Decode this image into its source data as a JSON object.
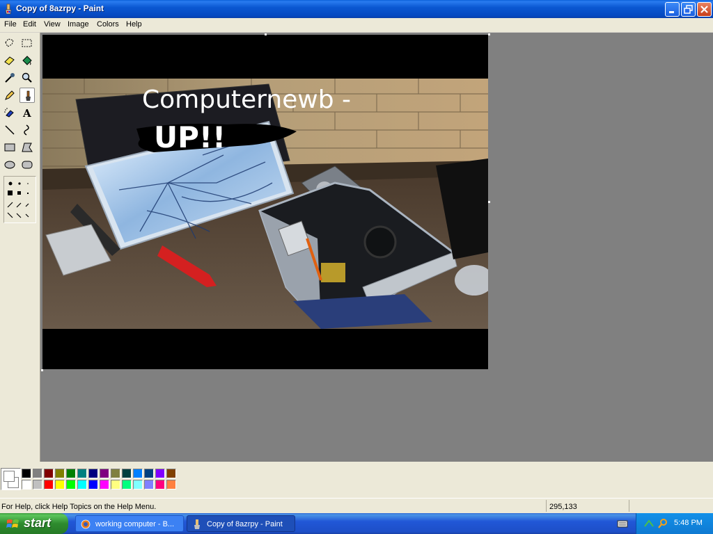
{
  "window": {
    "title": "Copy of 8azrpy - Paint",
    "controls": [
      "minimize",
      "maximize",
      "close"
    ]
  },
  "menu": {
    "items": [
      "File",
      "Edit",
      "View",
      "Image",
      "Colors",
      "Help"
    ]
  },
  "toolbox": {
    "tools": [
      "free-form-select-icon",
      "select-icon",
      "eraser-icon",
      "fill-icon",
      "pick-color-icon",
      "magnifier-icon",
      "pencil-icon",
      "brush-icon",
      "airbrush-icon",
      "text-icon",
      "line-icon",
      "curve-icon",
      "rectangle-icon",
      "polygon-icon",
      "ellipse-icon",
      "rounded-rectangle-icon"
    ],
    "selected_tool": "brush-icon"
  },
  "canvas": {
    "overlay_text": "Computernewb -",
    "overlay_text_2": "UP!!"
  },
  "palette": {
    "foreground": "#ffffff",
    "background": "#ffffff",
    "colors": [
      "#000000",
      "#808080",
      "#800000",
      "#808000",
      "#008000",
      "#008080",
      "#000080",
      "#800080",
      "#808040",
      "#004040",
      "#0080ff",
      "#004080",
      "#8000ff",
      "#804000",
      "#ffffff",
      "#c0c0c0",
      "#ff0000",
      "#ffff00",
      "#00ff00",
      "#00ffff",
      "#0000ff",
      "#ff00ff",
      "#ffff80",
      "#00ff80",
      "#80ffff",
      "#8080ff",
      "#ff0080",
      "#ff8040"
    ]
  },
  "statusbar": {
    "help_text": "For Help, click Help Topics on the Help Menu.",
    "coordinates": "295,133"
  },
  "taskbar": {
    "start_label": "start",
    "tasks": [
      {
        "label": "working computer - B...",
        "active": false
      },
      {
        "label": "Copy of 8azrpy - Paint",
        "active": true
      }
    ],
    "clock": "5:48 PM"
  }
}
